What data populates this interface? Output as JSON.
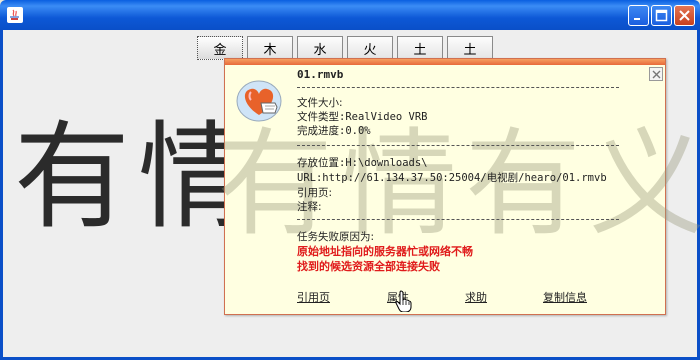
{
  "window": {
    "title": ""
  },
  "tabs": [
    "金",
    "木",
    "水",
    "火",
    "土",
    "土"
  ],
  "background_text": "有情有义",
  "popup": {
    "filename": "01.rmvb",
    "file_size_label": "文件大小:",
    "file_type": "文件类型:RealVideo VRB",
    "progress": "完成进度:0.0%",
    "save_location": "存放位置:H:\\downloads\\",
    "url": "URL:http://61.134.37.50:25004/电视剧/hearo/01.rmvb",
    "referer_label": "引用页:",
    "note_label": "注释:",
    "failure_title": "任务失败原因为:",
    "failure_reasons": [
      "原始地址指向的服务器忙或网络不畅",
      "找到的候选资源全部连接失败"
    ],
    "links": [
      "引用页",
      "属性",
      "求助",
      "复制信息"
    ]
  },
  "colors": {
    "titlebar": "#0a5fe0",
    "popup_bg": "#ffffe1",
    "error": "#e01b1b"
  }
}
